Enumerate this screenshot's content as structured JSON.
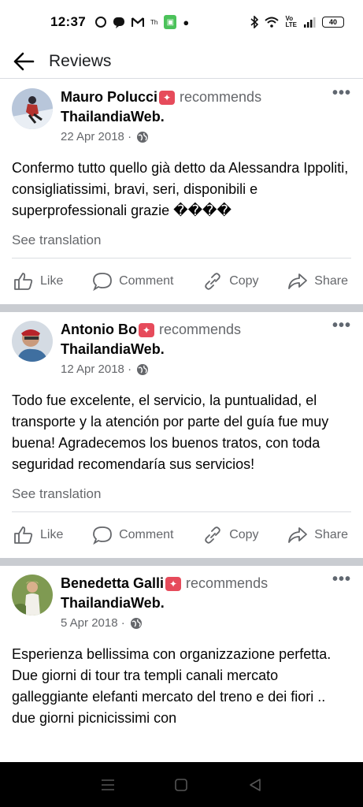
{
  "status_bar": {
    "time": "12:37",
    "left_icons": [
      "target-icon",
      "line-icon",
      "gmail-icon",
      "thai-app-icon",
      "shopping-bag-icon",
      "dot-icon"
    ],
    "right_icons": [
      "bluetooth-icon",
      "wifi-icon",
      "volte-icon",
      "signal-icon"
    ],
    "battery": "40"
  },
  "header": {
    "title": "Reviews"
  },
  "reviews": [
    {
      "author": "Mauro Polucci",
      "recommends": "recommends",
      "page": "ThailandiaWeb",
      "period": ".",
      "date": "22 Apr 2018 ·",
      "text": "Confermo tutto quello già detto da Alessandra Ippoliti, consigliatissimi, bravi,  seri, disponibili e superprofessionali grazie ����",
      "see_translation": "See translation",
      "avatar_colors": [
        "#9ab0cc",
        "#5d6f8c"
      ]
    },
    {
      "author": "Antonio Bo",
      "recommends": "recommends",
      "page": "ThailandiaWeb",
      "period": ".",
      "date": "12 Apr 2018 ·",
      "text": "Todo fue excelente, el servicio, la puntualidad, el transporte y la atención por parte del guía fue muy buena! Agradecemos los buenos tratos, con toda seguridad recomendaría sus servicios!",
      "see_translation": "See translation",
      "avatar_colors": [
        "#c9d2dc",
        "#7e6b60"
      ]
    },
    {
      "author": "Benedetta Galli",
      "recommends": "recommends",
      "page": "ThailandiaWeb",
      "period": ".",
      "date": "5 Apr 2018 ·",
      "text": "Esperienza bellissima  con organizzazione perfetta. Due giorni di tour tra templi canali mercato galleggiante elefanti mercato del treno e dei fiori .. due giorni picnicissimi con",
      "see_translation": "",
      "avatar_colors": [
        "#8aa05a",
        "#c4a37a"
      ]
    }
  ],
  "actions": {
    "like": "Like",
    "comment": "Comment",
    "copy": "Copy",
    "share": "Share"
  },
  "colors": {
    "badge": "#e64b5b",
    "separator": "#c9ccd1",
    "secondary_text": "#65676b"
  }
}
